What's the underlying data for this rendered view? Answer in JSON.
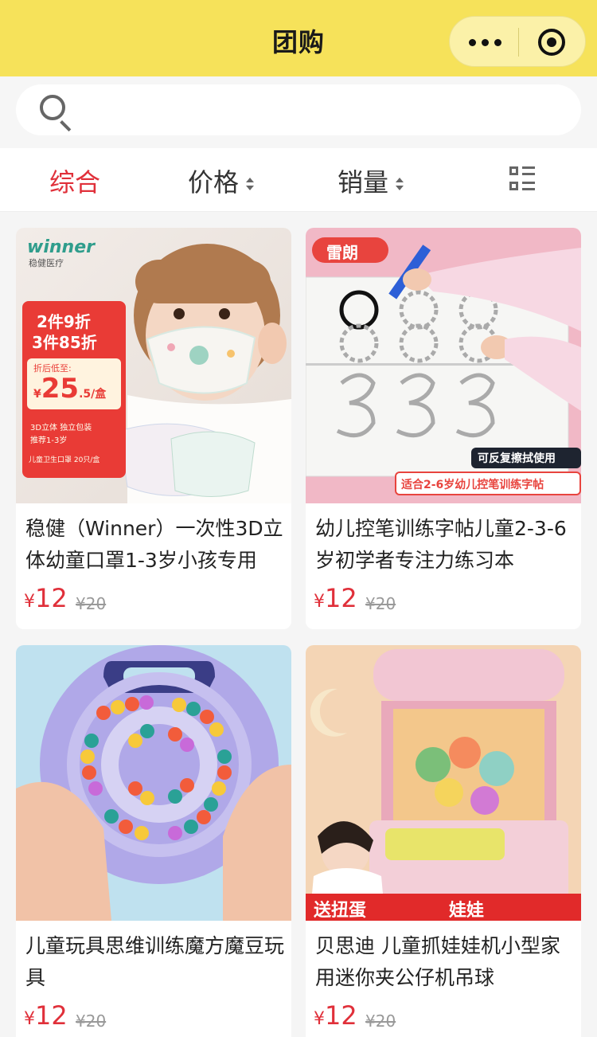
{
  "header": {
    "title": "团购"
  },
  "search": {
    "placeholder": ""
  },
  "sort": {
    "tabs": [
      "综合",
      "价格",
      "销量"
    ]
  },
  "products": [
    {
      "name": "稳健（Winner）一次性3D立体幼童口罩1-3岁小孩专用",
      "price_symbol": "¥",
      "price": "12",
      "original_price": "¥20",
      "image_text": {
        "brand": "winner",
        "brand_sub": "稳健医疗",
        "promo1": "2件9折",
        "promo2": "3件85折",
        "promo3": "折后低至:",
        "price": "25",
        "price_unit": ".5/盒",
        "note1": "3D立体 独立包装",
        "note2": "推荐1-3岁",
        "note3": "儿童卫生口罩 20只/盒"
      }
    },
    {
      "name": "幼儿控笔训练字帖儿童2-3-6岁初学者专注力练习本",
      "price_symbol": "¥",
      "price": "12",
      "original_price": "¥20",
      "image_text": {
        "brand": "雷朗",
        "badge1": "可反复擦拭使用",
        "badge2": "适合2-6岁幼儿控笔训练字帖"
      }
    },
    {
      "name": "儿童玩具思维训练魔方魔豆玩具",
      "price_symbol": "¥",
      "price": "12",
      "original_price": "¥20",
      "image_text": {}
    },
    {
      "name": "贝思迪 儿童抓娃娃机小型家用迷你夹公仔机吊球",
      "price_symbol": "¥",
      "price": "12",
      "original_price": "¥20",
      "image_text": {
        "banner_left": "送扭蛋",
        "banner_right": "娃娃"
      }
    }
  ],
  "colors": {
    "header_bg": "#f6e25a",
    "price": "#e0303a",
    "active_tab": "#e0303a"
  },
  "icons": [
    "more-dots-icon",
    "target-icon",
    "search-icon",
    "sort-arrows-icon",
    "list-view-icon"
  ]
}
